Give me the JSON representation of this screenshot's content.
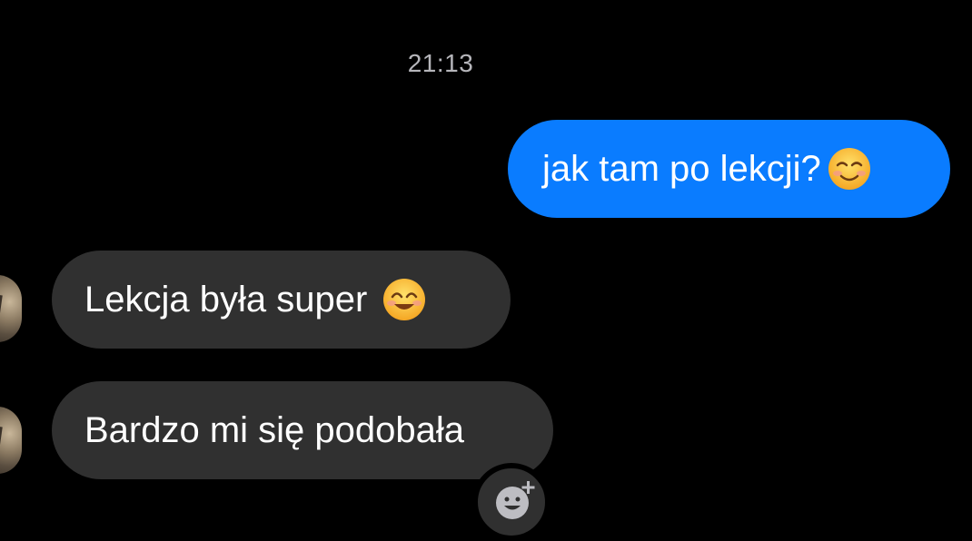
{
  "chat": {
    "timestamp": "21:13",
    "messages": [
      {
        "direction": "outgoing",
        "text": "jak tam po lekcji?",
        "emoji": "smiling-face-icon",
        "bubble_color": "#0a7cff"
      },
      {
        "direction": "incoming",
        "text": "Lekcja była super",
        "emoji": "smiling-face-with-smiling-eyes-icon",
        "bubble_color": "#303030"
      },
      {
        "direction": "incoming",
        "text": "Bardzo mi się podobała",
        "bubble_color": "#303030"
      }
    ]
  },
  "colors": {
    "background": "#000000",
    "outgoing_bubble": "#0a7cff",
    "incoming_bubble": "#303030",
    "timestamp_text": "#b6b6bb"
  },
  "icons": {
    "reaction_button": "add-reaction-icon"
  }
}
